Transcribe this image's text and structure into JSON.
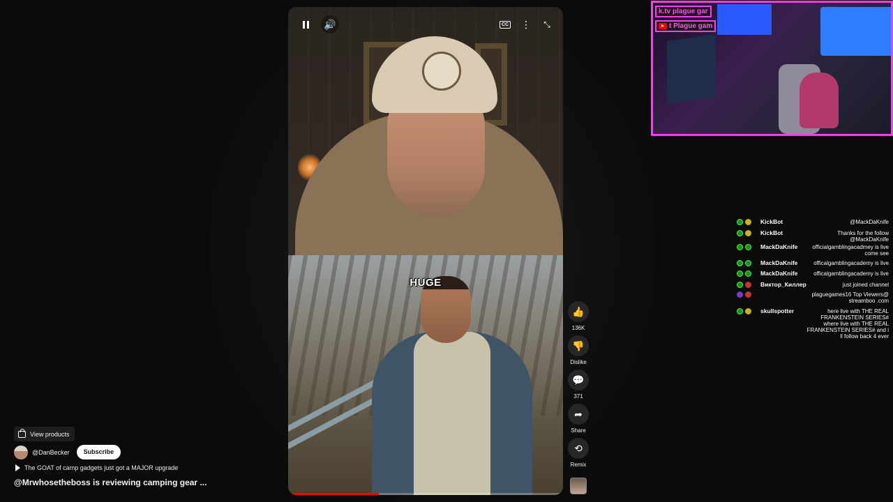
{
  "player": {
    "caption_overlay": "HUGE",
    "progress_fraction": 0.33
  },
  "actions": {
    "like_count": "136K",
    "dislike_label": "Dislike",
    "comment_count": "371",
    "share_label": "Share",
    "remix_label": "Remix"
  },
  "info": {
    "view_products": "View products",
    "channel_handle": "@DanBecker",
    "subscribe_label": "Subscribe",
    "related_video": "The GOAT of camp gadgets just got a MAJOR upgrade",
    "title": "@Mrwhosetheboss is reviewing camping gear ..."
  },
  "stream_overlay": {
    "kick_tag": "k.tv plague gar",
    "youtube_tag": "t Plague gam"
  },
  "chat": [
    {
      "user": "KickBot",
      "text": "@MackDaKnife",
      "icons": [
        "g",
        "ye"
      ]
    },
    {
      "user": "KickBot",
      "text": "Thanks for the follow @MackDaKnife",
      "icons": [
        "g",
        "ye"
      ]
    },
    {
      "user": "MackDaKnife",
      "text": "officialgamblingacadmey is live come see",
      "icons": [
        "g",
        "g"
      ]
    },
    {
      "user": "MackDaKnife",
      "text": "officalgamblingacademy is live",
      "icons": [
        "g",
        "g"
      ]
    },
    {
      "user": "MackDaKnife",
      "text": "officalgamblingacademy is live",
      "icons": [
        "g",
        "g"
      ]
    },
    {
      "user": "Виктор_Киллер",
      "text": "just joined channel",
      "icons": [
        "g",
        "rd"
      ]
    },
    {
      "user": "",
      "text": "plaguegames16 Top Viewers@ streamboo .com",
      "icons": [
        "pu",
        "rd"
      ]
    },
    {
      "user": "skullspotter",
      "text": "here live with THE REAL FRANKENSTEIN SERIES# where live with THE REAL FRANKENSTEIN SERIES# and i ll follow back 4 ever",
      "icons": [
        "g",
        "ye"
      ]
    }
  ]
}
